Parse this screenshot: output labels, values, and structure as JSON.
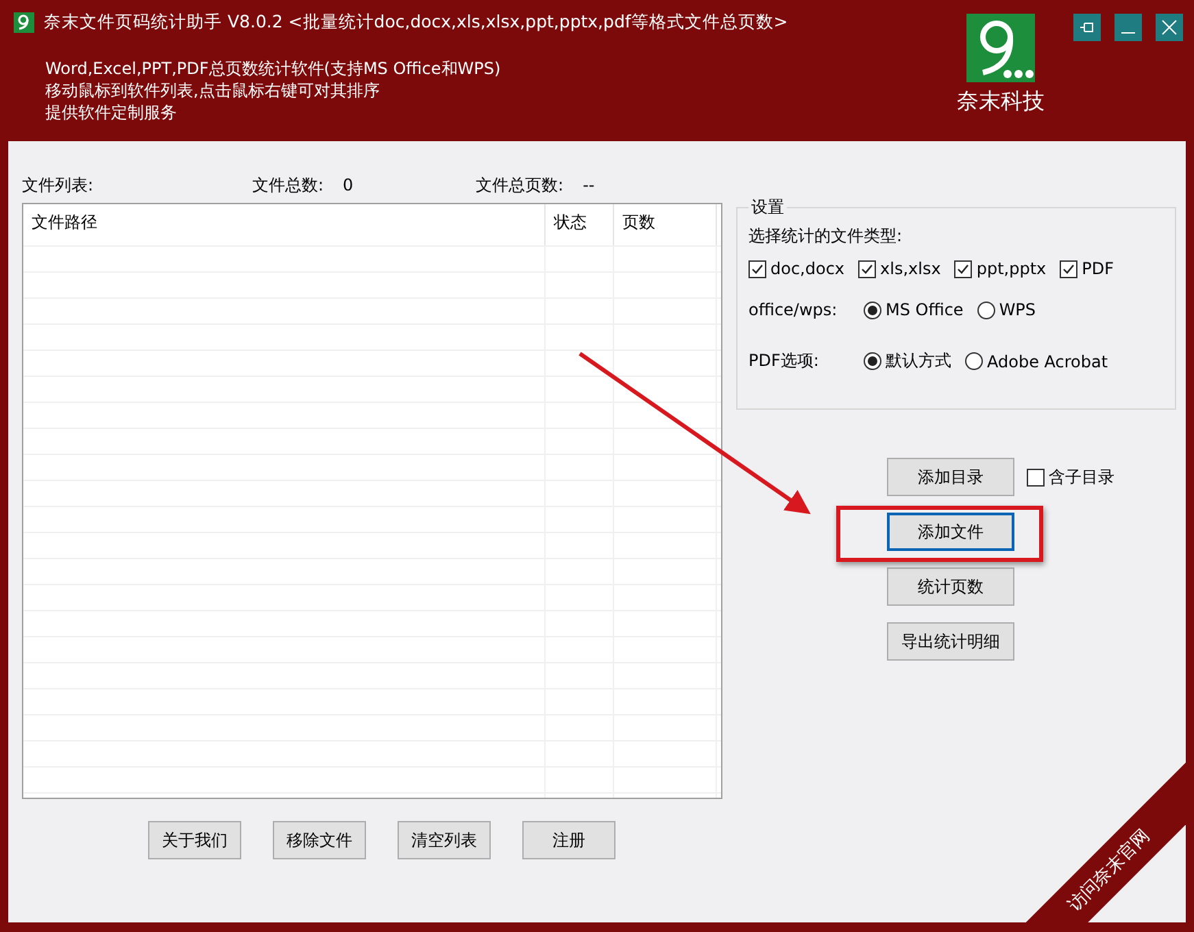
{
  "header": {
    "title": "奈末文件页码统计助手  V8.0.2  <批量统计doc,docx,xls,xlsx,ppt,pptx,pdf等格式文件总页数>",
    "info_lines": [
      "Word,Excel,PPT,PDF总页数统计软件(支持MS  Office和WPS)",
      "移动鼠标到软件列表,点击鼠标右键可对其排序",
      "提供软件定制服务"
    ],
    "logo_caption": "奈末科技"
  },
  "file_list": {
    "label": "文件列表:",
    "count_label": "文件总数:",
    "count": "0",
    "pages_label": "文件总页数:",
    "pages": "--",
    "columns": [
      "文件路径",
      "状态",
      "页数"
    ]
  },
  "settings": {
    "title": "设置",
    "file_types_label": "选择统计的文件类型:",
    "file_types": [
      {
        "label": "doc,docx",
        "checked": true
      },
      {
        "label": "xls,xlsx",
        "checked": true
      },
      {
        "label": "ppt,pptx",
        "checked": true
      },
      {
        "label": "PDF",
        "checked": true
      }
    ],
    "office_label": "office/wps:",
    "office_options": [
      {
        "label": "MS Office",
        "selected": true
      },
      {
        "label": "WPS",
        "selected": false
      }
    ],
    "pdf_label": "PDF选项:",
    "pdf_options": [
      {
        "label": "默认方式",
        "selected": true
      },
      {
        "label": "Adobe Acrobat",
        "selected": false
      }
    ]
  },
  "actions": [
    {
      "label": "添加目录",
      "focused": false
    },
    {
      "label": "添加文件",
      "focused": true
    },
    {
      "label": "统计页数",
      "focused": false
    },
    {
      "label": "导出统计明细",
      "focused": false
    }
  ],
  "include_subdirs": {
    "label": "含子目录",
    "checked": false
  },
  "bottom_buttons": [
    "关于我们",
    "移除文件",
    "清空列表",
    "注册"
  ],
  "corner_ribbon": "访问奈末官网"
}
